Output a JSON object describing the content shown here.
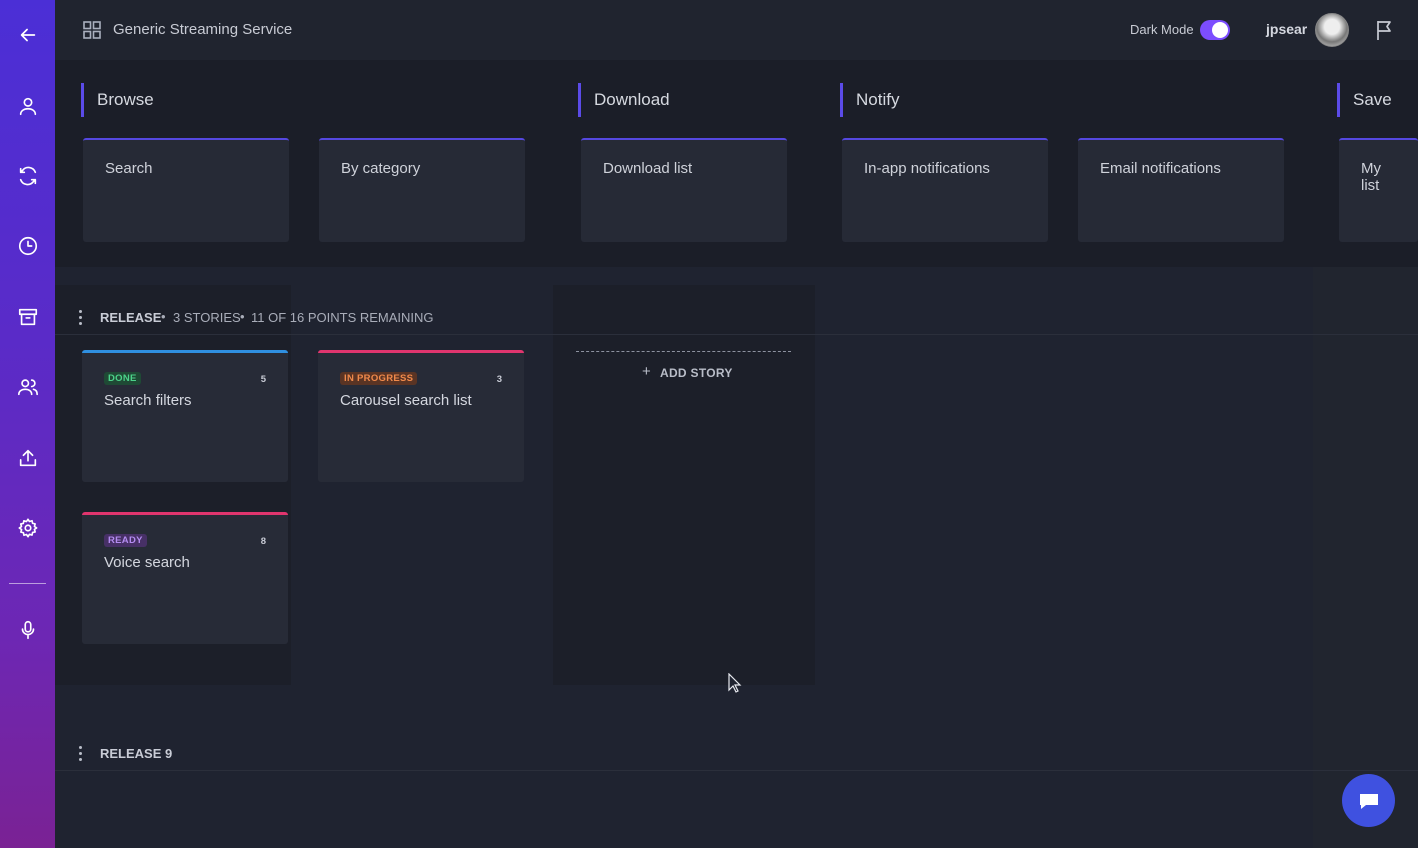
{
  "sidebar": {
    "items": [
      {
        "icon": "arrow-left-icon"
      },
      {
        "icon": "user-icon"
      },
      {
        "icon": "refresh-icon"
      },
      {
        "icon": "clock-icon"
      },
      {
        "icon": "archive-icon"
      },
      {
        "icon": "users-icon"
      },
      {
        "icon": "upload-icon"
      },
      {
        "icon": "gear-icon"
      },
      {
        "icon": "microphone-icon"
      }
    ]
  },
  "header": {
    "app_title": "Generic Streaming Service",
    "dark_mode_label": "Dark Mode",
    "dark_mode_on": true,
    "username": "jpsear"
  },
  "epics": [
    {
      "title": "Browse",
      "features": [
        "Search",
        "By category"
      ]
    },
    {
      "title": "Download",
      "features": [
        "Download list"
      ]
    },
    {
      "title": "Notify",
      "features": [
        "In-app notifications",
        "Email notifications"
      ]
    },
    {
      "title": "Save",
      "features": [
        "My list"
      ]
    }
  ],
  "release": {
    "name": "RELEASE",
    "stories_count": "3 STORIES",
    "points_remaining": "11 OF 16 POINTS REMAINING",
    "stories": [
      {
        "status": "DONE",
        "points": "5",
        "title": "Search filters",
        "color": "#2f8fe0",
        "badge_bg": "#1f4a35",
        "badge_fg": "#4cd38a"
      },
      {
        "status": "IN PROGRESS",
        "points": "3",
        "title": "Carousel search list",
        "color": "#e0356e",
        "badge_bg": "#5a3424",
        "badge_fg": "#f08a4b"
      },
      {
        "status": "READY",
        "points": "8",
        "title": "Voice search",
        "color": "#e0356e",
        "badge_bg": "#473066",
        "badge_fg": "#b48cf0"
      }
    ],
    "add_story_label": "ADD STORY"
  },
  "release9": {
    "name": "RELEASE 9"
  },
  "colors": {
    "accent": "#5b4be8",
    "sidebar_top": "#4b2fd6",
    "sidebar_bottom": "#7a2294",
    "chat_button": "#3f51e0"
  }
}
